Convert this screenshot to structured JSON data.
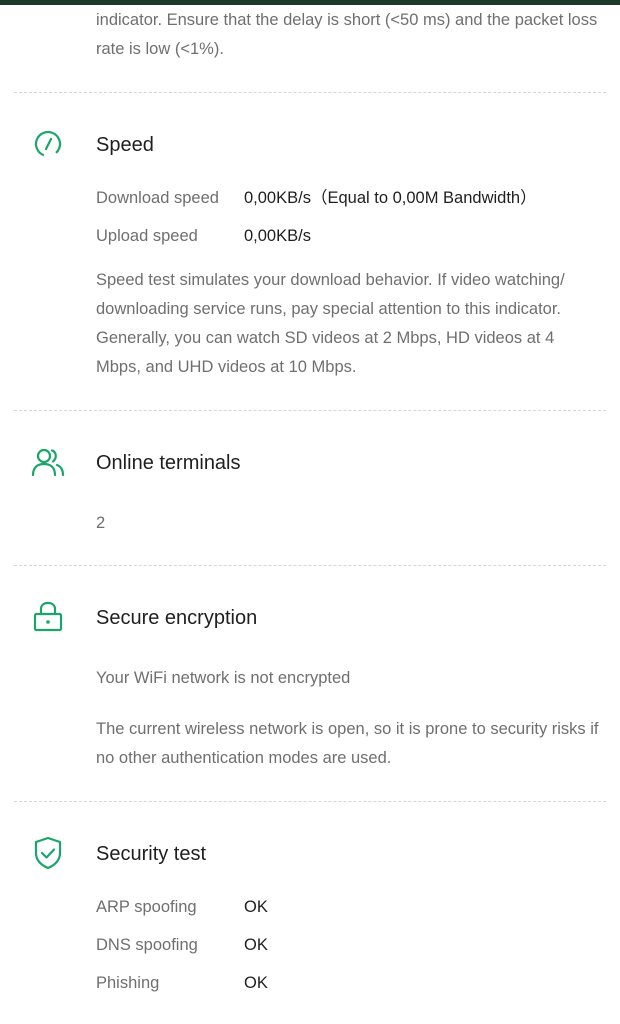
{
  "colors": {
    "accent": "#1aa56a",
    "top_bar": "#1e3a2b",
    "divider": "#d6d6d6"
  },
  "latency_tail": "indicator. Ensure that the delay is short (<50 ms) and the packet loss rate is low (<1%).",
  "speed": {
    "icon": "speedometer-icon",
    "title": "Speed",
    "rows": [
      {
        "label": "Download speed",
        "value": "0,00KB/s（Equal to 0,00M Bandwidth）"
      },
      {
        "label": "Upload speed",
        "value": "0,00KB/s"
      }
    ],
    "description": "Speed test simulates your download behavior. If video watching/ downloading service runs, pay special attention to this indicator. Generally, you can watch SD videos at 2 Mbps, HD videos at 4 Mbps, and UHD videos at 10 Mbps."
  },
  "terminals": {
    "icon": "users-icon",
    "title": "Online terminals",
    "value": "2"
  },
  "encryption": {
    "icon": "lock-icon",
    "title": "Secure encryption",
    "status": "Your WiFi network is not encrypted",
    "description": "The current wireless network is open, so it is prone to security risks if no other authentication modes are used."
  },
  "security": {
    "icon": "shield-check-icon",
    "title": "Security test",
    "rows": [
      {
        "label": "ARP spoofing",
        "value": "OK"
      },
      {
        "label": "DNS spoofing",
        "value": "OK"
      },
      {
        "label": "Phishing",
        "value": "OK"
      }
    ]
  }
}
